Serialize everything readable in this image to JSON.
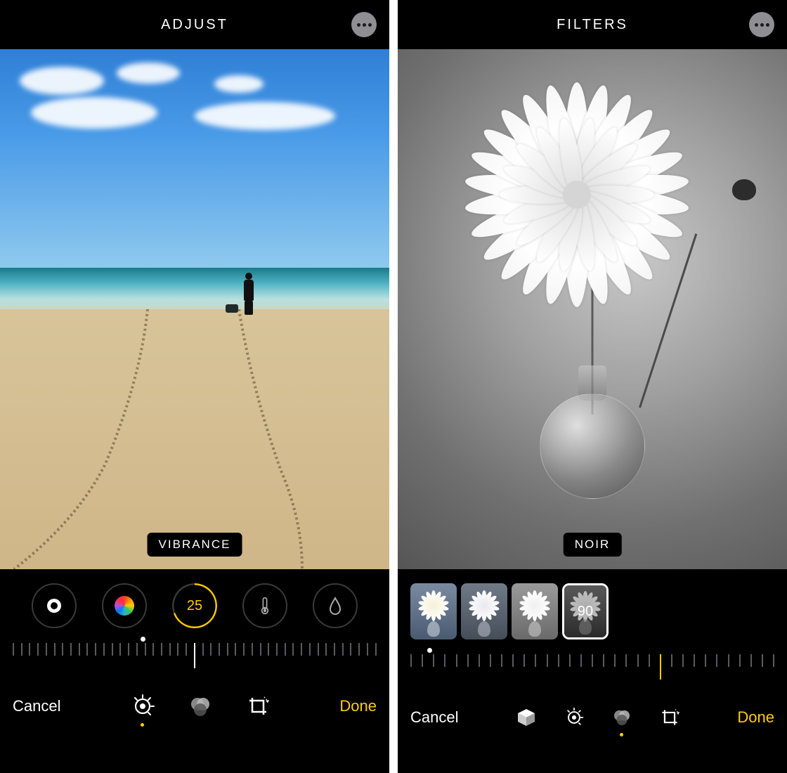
{
  "left": {
    "header_title": "ADJUST",
    "chip_label": "VIBRANCE",
    "active_value": "25",
    "cancel_label": "Cancel",
    "done_label": "Done",
    "adjust_tools": [
      {
        "id": "auto",
        "icon": "target-dot-icon",
        "selected": false
      },
      {
        "id": "color",
        "icon": "rainbow-circle-icon",
        "selected": false
      },
      {
        "id": "vibrance",
        "icon": "value-ring",
        "selected": true,
        "value": "25"
      },
      {
        "id": "warmth",
        "icon": "thermometer-icon",
        "selected": false
      },
      {
        "id": "tint",
        "icon": "droplet-icon",
        "selected": false
      }
    ],
    "bottom_modes": [
      {
        "id": "adjust",
        "icon": "adjust-dial-icon",
        "selected": true
      },
      {
        "id": "filters",
        "icon": "three-circles-icon",
        "selected": false
      },
      {
        "id": "crop",
        "icon": "crop-rotate-icon",
        "selected": false
      }
    ]
  },
  "right": {
    "header_title": "FILTERS",
    "chip_label": "NOIR",
    "active_value": "90",
    "cancel_label": "Cancel",
    "done_label": "Done",
    "filter_thumbs": [
      {
        "id": "vivid-warm",
        "selected": false
      },
      {
        "id": "dramatic",
        "selected": false
      },
      {
        "id": "silvertone",
        "selected": false
      },
      {
        "id": "noir",
        "selected": true,
        "value": "90"
      }
    ],
    "bottom_modes": [
      {
        "id": "markup",
        "icon": "cube-icon",
        "selected": false
      },
      {
        "id": "adjust",
        "icon": "adjust-dial-icon",
        "selected": false
      },
      {
        "id": "filters",
        "icon": "three-circles-icon",
        "selected": true
      },
      {
        "id": "crop",
        "icon": "crop-rotate-icon",
        "selected": false
      }
    ]
  },
  "colors": {
    "accent": "#ffcc00",
    "bg": "#000000"
  }
}
